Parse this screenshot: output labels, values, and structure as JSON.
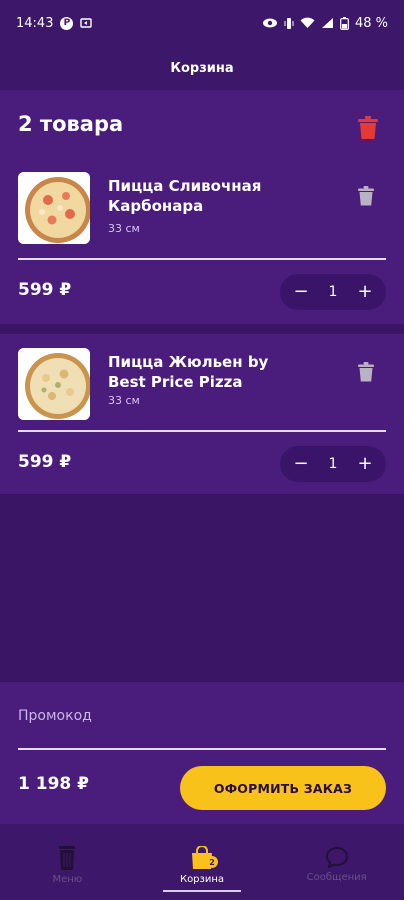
{
  "status": {
    "time": "14:43",
    "battery": "48 %",
    "icons": [
      "notification-p-icon",
      "cast-icon",
      "eye-icon",
      "vibrate-icon",
      "wifi-icon",
      "signal-icon",
      "battery-icon"
    ]
  },
  "header": {
    "title": "Корзина"
  },
  "cart": {
    "count_label": "2 товара",
    "items": [
      {
        "name": "Пицца Сливочная Карбонара",
        "size": "33 см",
        "price": "599 ₽",
        "quantity": "1"
      },
      {
        "name": "Пицца Жюльен by Best Price Pizza",
        "size": "33 см",
        "price": "599 ₽",
        "quantity": "1"
      }
    ]
  },
  "stepper": {
    "minus": "−",
    "plus": "+"
  },
  "checkout": {
    "promo_placeholder": "Промокод",
    "total": "1 198 ₽",
    "order_button": "ОФОРМИТЬ ЗАКАЗ"
  },
  "nav": {
    "items": [
      {
        "label": "Меню",
        "icon": "menu-can-icon",
        "active": false
      },
      {
        "label": "Корзина",
        "icon": "shopping-bag-icon",
        "active": true,
        "badge": "2"
      },
      {
        "label": "Сообщения",
        "icon": "chat-bubble-icon",
        "active": false
      }
    ]
  },
  "colors": {
    "background": "#3a1565",
    "card": "#4a1c7c",
    "accent": "#f8c21a",
    "danger": "#e53935"
  }
}
